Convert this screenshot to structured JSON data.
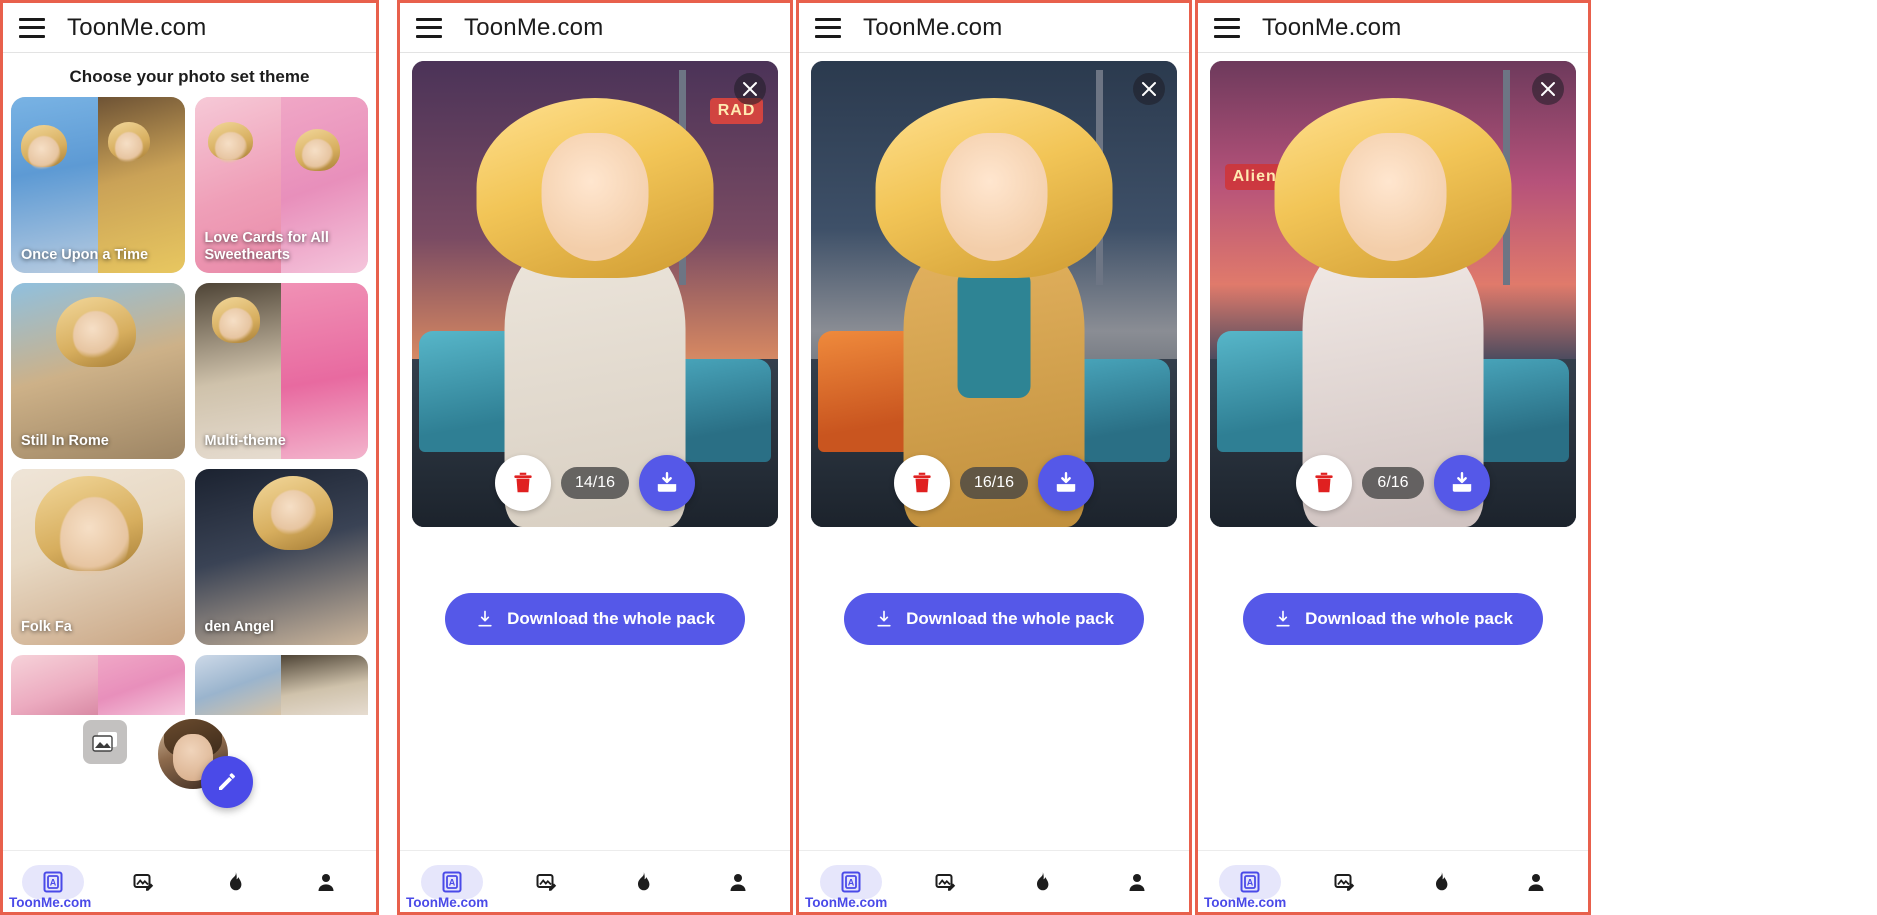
{
  "app": {
    "title": "ToonMe.com",
    "brand_footer": "ToonMe.com",
    "accent_color": "#5558e8",
    "frame_color": "#e8604c"
  },
  "chooser": {
    "heading": "Choose your photo set theme",
    "themes": [
      {
        "label": "Once Upon a Time",
        "art": "a-castle",
        "art2": "a-yellow"
      },
      {
        "label": "Love Cards for All Sweethearts",
        "art": "a-pinkheart",
        "art2": "a-pinkglow"
      },
      {
        "label": "Still In Rome",
        "art": "a-rome",
        "art2": "a-rome"
      },
      {
        "label": "Multi-theme",
        "art": "a-multi1",
        "art2": "a-multi2"
      },
      {
        "label": "Folk Fa",
        "art": "a-folk",
        "art2": "a-folk"
      },
      {
        "label": "den Angel",
        "art": "a-angel",
        "art2": "a-angel"
      }
    ],
    "floating": {
      "photo_chip_icon": "photo-library-icon",
      "avatar_name": "user-avatar",
      "edit_fab_icon": "pencil-icon"
    }
  },
  "bottom_nav": {
    "items": [
      {
        "name": "photo-frame",
        "icon": "photo-frame-icon",
        "active": true
      },
      {
        "name": "edit-photo",
        "icon": "edit-photo-icon",
        "active": false
      },
      {
        "name": "trending",
        "icon": "flame-icon",
        "active": false
      },
      {
        "name": "profile",
        "icon": "person-icon",
        "active": false
      }
    ]
  },
  "results": [
    {
      "counter": "14/16",
      "close_icon": "close-icon",
      "delete_icon": "trash-icon",
      "save_icon": "download-circle-icon",
      "pack_button": "Download the whole pack",
      "pack_icon": "download-icon",
      "scene": "sky2",
      "car_class": "car-l",
      "body_class": "",
      "neon_text": "RAD",
      "show_inner": false
    },
    {
      "counter": "16/16",
      "close_icon": "close-icon",
      "delete_icon": "trash-icon",
      "save_icon": "download-circle-icon",
      "pack_button": "Download the whole pack",
      "pack_icon": "download-icon",
      "scene": "sky3",
      "car_class": "car-l orange",
      "body_class": "jacket",
      "neon_text": "",
      "show_inner": true
    },
    {
      "counter": "6/16",
      "close_icon": "close-icon",
      "delete_icon": "trash-icon",
      "save_icon": "download-circle-icon",
      "pack_button": "Download the whole pack",
      "pack_icon": "download-icon",
      "scene": "sky4",
      "car_class": "car-l",
      "body_class": "tank",
      "neon_text": "Alien",
      "show_inner": false
    }
  ]
}
